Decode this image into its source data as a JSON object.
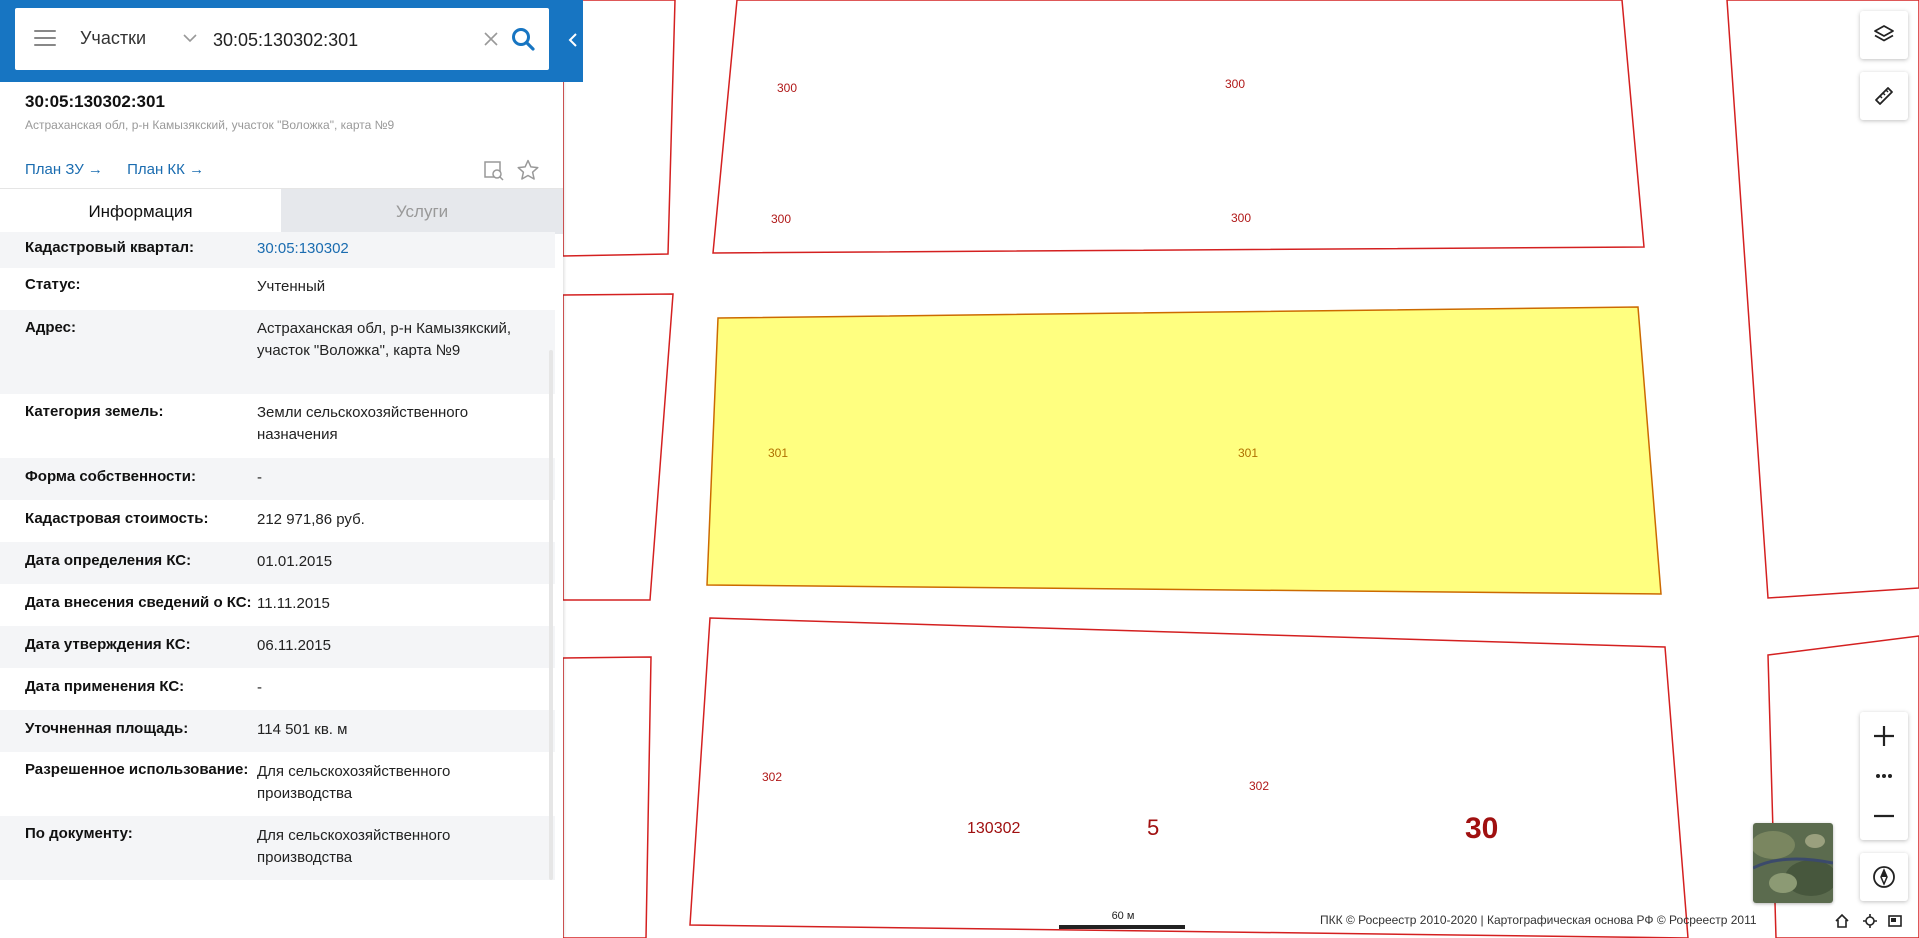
{
  "search": {
    "type_label": "Участки",
    "query": "30:05:130302:301"
  },
  "parcel": {
    "cad_number": "30:05:130302:301",
    "address_short": "Астраханская обл, р-н Камызякский, участок \"Воложка\", карта №9",
    "links": [
      "План ЗУ →",
      "План КК →"
    ]
  },
  "tabs": {
    "info": "Информация",
    "services": "Услуги"
  },
  "info": [
    {
      "k": "Кадастровый квартал:",
      "v": "30:05:130302"
    },
    {
      "k": "Статус:",
      "v": "Учтенный"
    },
    {
      "k": "Адрес:",
      "v": "Астраханская обл, р-н Камызякский, участок \"Воложка\", карта №9"
    },
    {
      "k": "Категория земель:",
      "v": "Земли сельскохозяйственного назначения"
    },
    {
      "k": "Форма собственности:",
      "v": "-"
    },
    {
      "k": "Кадастровая стоимость:",
      "v": "212 971,86 руб."
    },
    {
      "k": "Дата определения КС:",
      "v": "01.01.2015"
    },
    {
      "k": "Дата внесения сведений о КС:",
      "v": "11.11.2015"
    },
    {
      "k": "Дата утверждения КС:",
      "v": "06.11.2015"
    },
    {
      "k": "Дата применения КС:",
      "v": "-"
    },
    {
      "k": "Уточненная площадь:",
      "v": "114 501 кв. м"
    },
    {
      "k": "Разрешенное использование:",
      "v": "Для сельскохозяйственного производства"
    },
    {
      "k": "По документу:",
      "v": "Для сельскохозяйственного производства"
    }
  ],
  "map": {
    "parcel_labels": [
      "300",
      "300",
      "300",
      "300",
      "301",
      "301",
      "302",
      "302"
    ],
    "quarter_number": "130302",
    "district_number": "5",
    "region_number": "30",
    "scale": "60 м",
    "attribution": "ПКК © Росреестр 2010-2020 | Картографическая основа РФ © Росреестр 2011",
    "selected_fill": "#ffff80",
    "boundary_color": "#d42020"
  }
}
